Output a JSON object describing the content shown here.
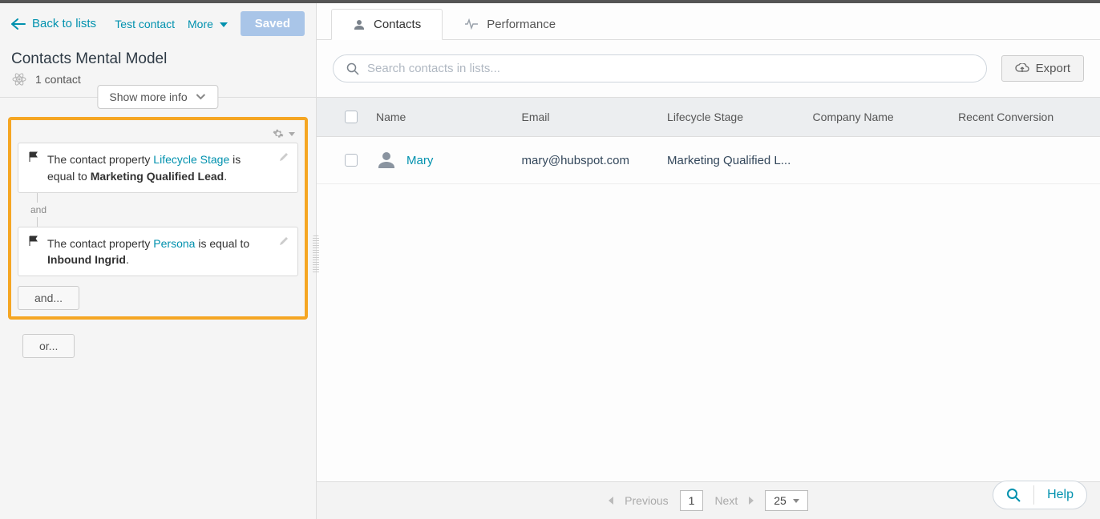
{
  "sidebar": {
    "back_label": "Back to lists",
    "test_contact": "Test contact",
    "more_label": "More",
    "saved_label": "Saved",
    "title": "Contacts Mental Model",
    "count_label": "1 contact",
    "show_more_label": "Show more info",
    "filters": [
      {
        "prefix": "The contact property ",
        "property": "Lifecycle Stage",
        "mid": " is equal to ",
        "value": "Marketing Qualified Lead",
        "suffix": "."
      },
      {
        "prefix": "The contact property ",
        "property": "Persona",
        "mid": " is equal to ",
        "value": "Inbound Ingrid",
        "suffix": "."
      }
    ],
    "connector": "and",
    "and_label": "and...",
    "or_label": "or..."
  },
  "tabs": [
    {
      "label": "Contacts",
      "active": true
    },
    {
      "label": "Performance",
      "active": false
    }
  ],
  "search": {
    "placeholder": "Search contacts in lists..."
  },
  "export_label": "Export",
  "columns": [
    "Name",
    "Email",
    "Lifecycle Stage",
    "Company Name",
    "Recent Conversion"
  ],
  "rows": [
    {
      "name": "Mary",
      "email": "mary@hubspot.com",
      "lifecycle": "Marketing Qualified L...",
      "company": "",
      "recent": ""
    }
  ],
  "pager": {
    "prev": "Previous",
    "page": "1",
    "next": "Next",
    "size": "25"
  },
  "help_label": "Help"
}
